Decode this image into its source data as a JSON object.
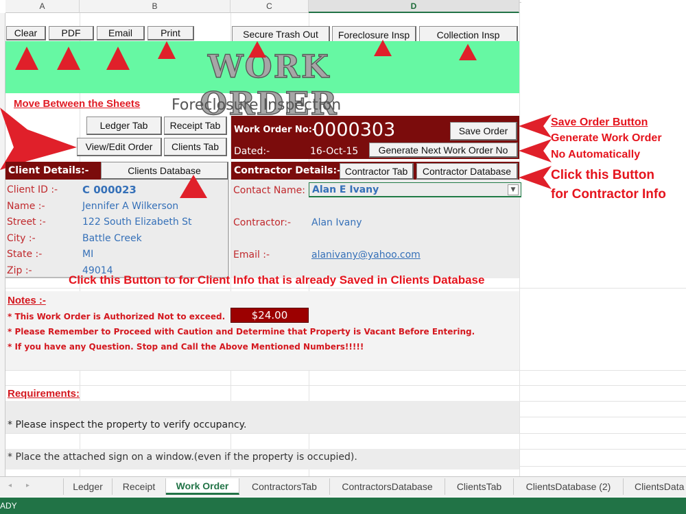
{
  "columns": {
    "a": "A",
    "b": "B",
    "c": "C",
    "d": "D"
  },
  "toolbar": {
    "clear": "Clear",
    "pdf": "PDF",
    "email": "Email",
    "print": "Print",
    "secure_trash_out": "Secure Trash Out",
    "foreclosure_insp": "Foreclosure Insp",
    "collection_insp": "Collection Insp"
  },
  "banner": {
    "title": "WORK ORDER"
  },
  "nav": {
    "move_link": "Move Between the Sheets",
    "subtitle": "Foreclosure Inspection",
    "ledger_tab": "Ledger Tab",
    "receipt_tab": "Receipt Tab",
    "view_edit_order": "View/Edit Order",
    "clients_tab": "Clients Tab"
  },
  "order": {
    "number_label": "Work Order No:-",
    "number": "0000303",
    "save_button": "Save Order",
    "dated_label": "Dated:-",
    "date": "16-Oct-15",
    "generate_button": "Generate Next Work Order No"
  },
  "client": {
    "header": "Client Details:-",
    "db_button": "Clients Database",
    "fields": [
      {
        "label": "Client ID :-",
        "value": "C  000023"
      },
      {
        "label": "Name :-",
        "value": "Jennifer A Wilkerson"
      },
      {
        "label": "Street :-",
        "value": "122 South Elizabeth St"
      },
      {
        "label": "City :-",
        "value": "Battle Creek"
      },
      {
        "label": "State :-",
        "value": "MI"
      },
      {
        "label": "Zip :-",
        "value": "49014"
      }
    ]
  },
  "contractor": {
    "header": "Contractor Details:-",
    "tab_button": "Contractor Tab",
    "db_button": "Contractor Database",
    "contact_label": "Contact Name:",
    "contact_value": "Alan E Ivany",
    "contractor_label": "Contractor:-",
    "contractor_value": "Alan Ivany",
    "email_label": "Email :-",
    "email_value": "alanivany@yahoo.com"
  },
  "callouts": {
    "save_line": "Save Order Button",
    "generate_line1": "Generate Work Order",
    "generate_line2": "No Automatically",
    "contractor_line1": "Click this Button",
    "contractor_line2": "for Contractor Info",
    "client_info": "Click this Button to for Client Info that is already Saved in Clients Database"
  },
  "notes": {
    "header": "Notes :-",
    "line1": "* This Work Order is Authorized Not to exceed.",
    "amount": "$24.00",
    "line2": "* Please Remember to Proceed with Caution and Determine that Property is Vacant Before Entering.",
    "line3": "* If you have any Question. Stop and Call the Above Mentioned Numbers!!!!!"
  },
  "requirements": {
    "header": "Requirements:",
    "line1": "* Please inspect the property to verify occupancy.",
    "line2": "* Place the attached sign on a window.(even if the property is occupied)."
  },
  "sheet_tabs": [
    "Ledger",
    "Receipt",
    "Work Order",
    "ContractorsTab",
    "ContractorsDatabase",
    "ClientsTab",
    "ClientsDatabase (2)",
    "ClientsData"
  ],
  "active_tab": "Work Order",
  "status": {
    "text": "ADY"
  },
  "colors": {
    "banner": "#66f8a3",
    "maroon": "#7b0c0c",
    "accent_red": "#e01b24",
    "excel_green": "#217346"
  }
}
